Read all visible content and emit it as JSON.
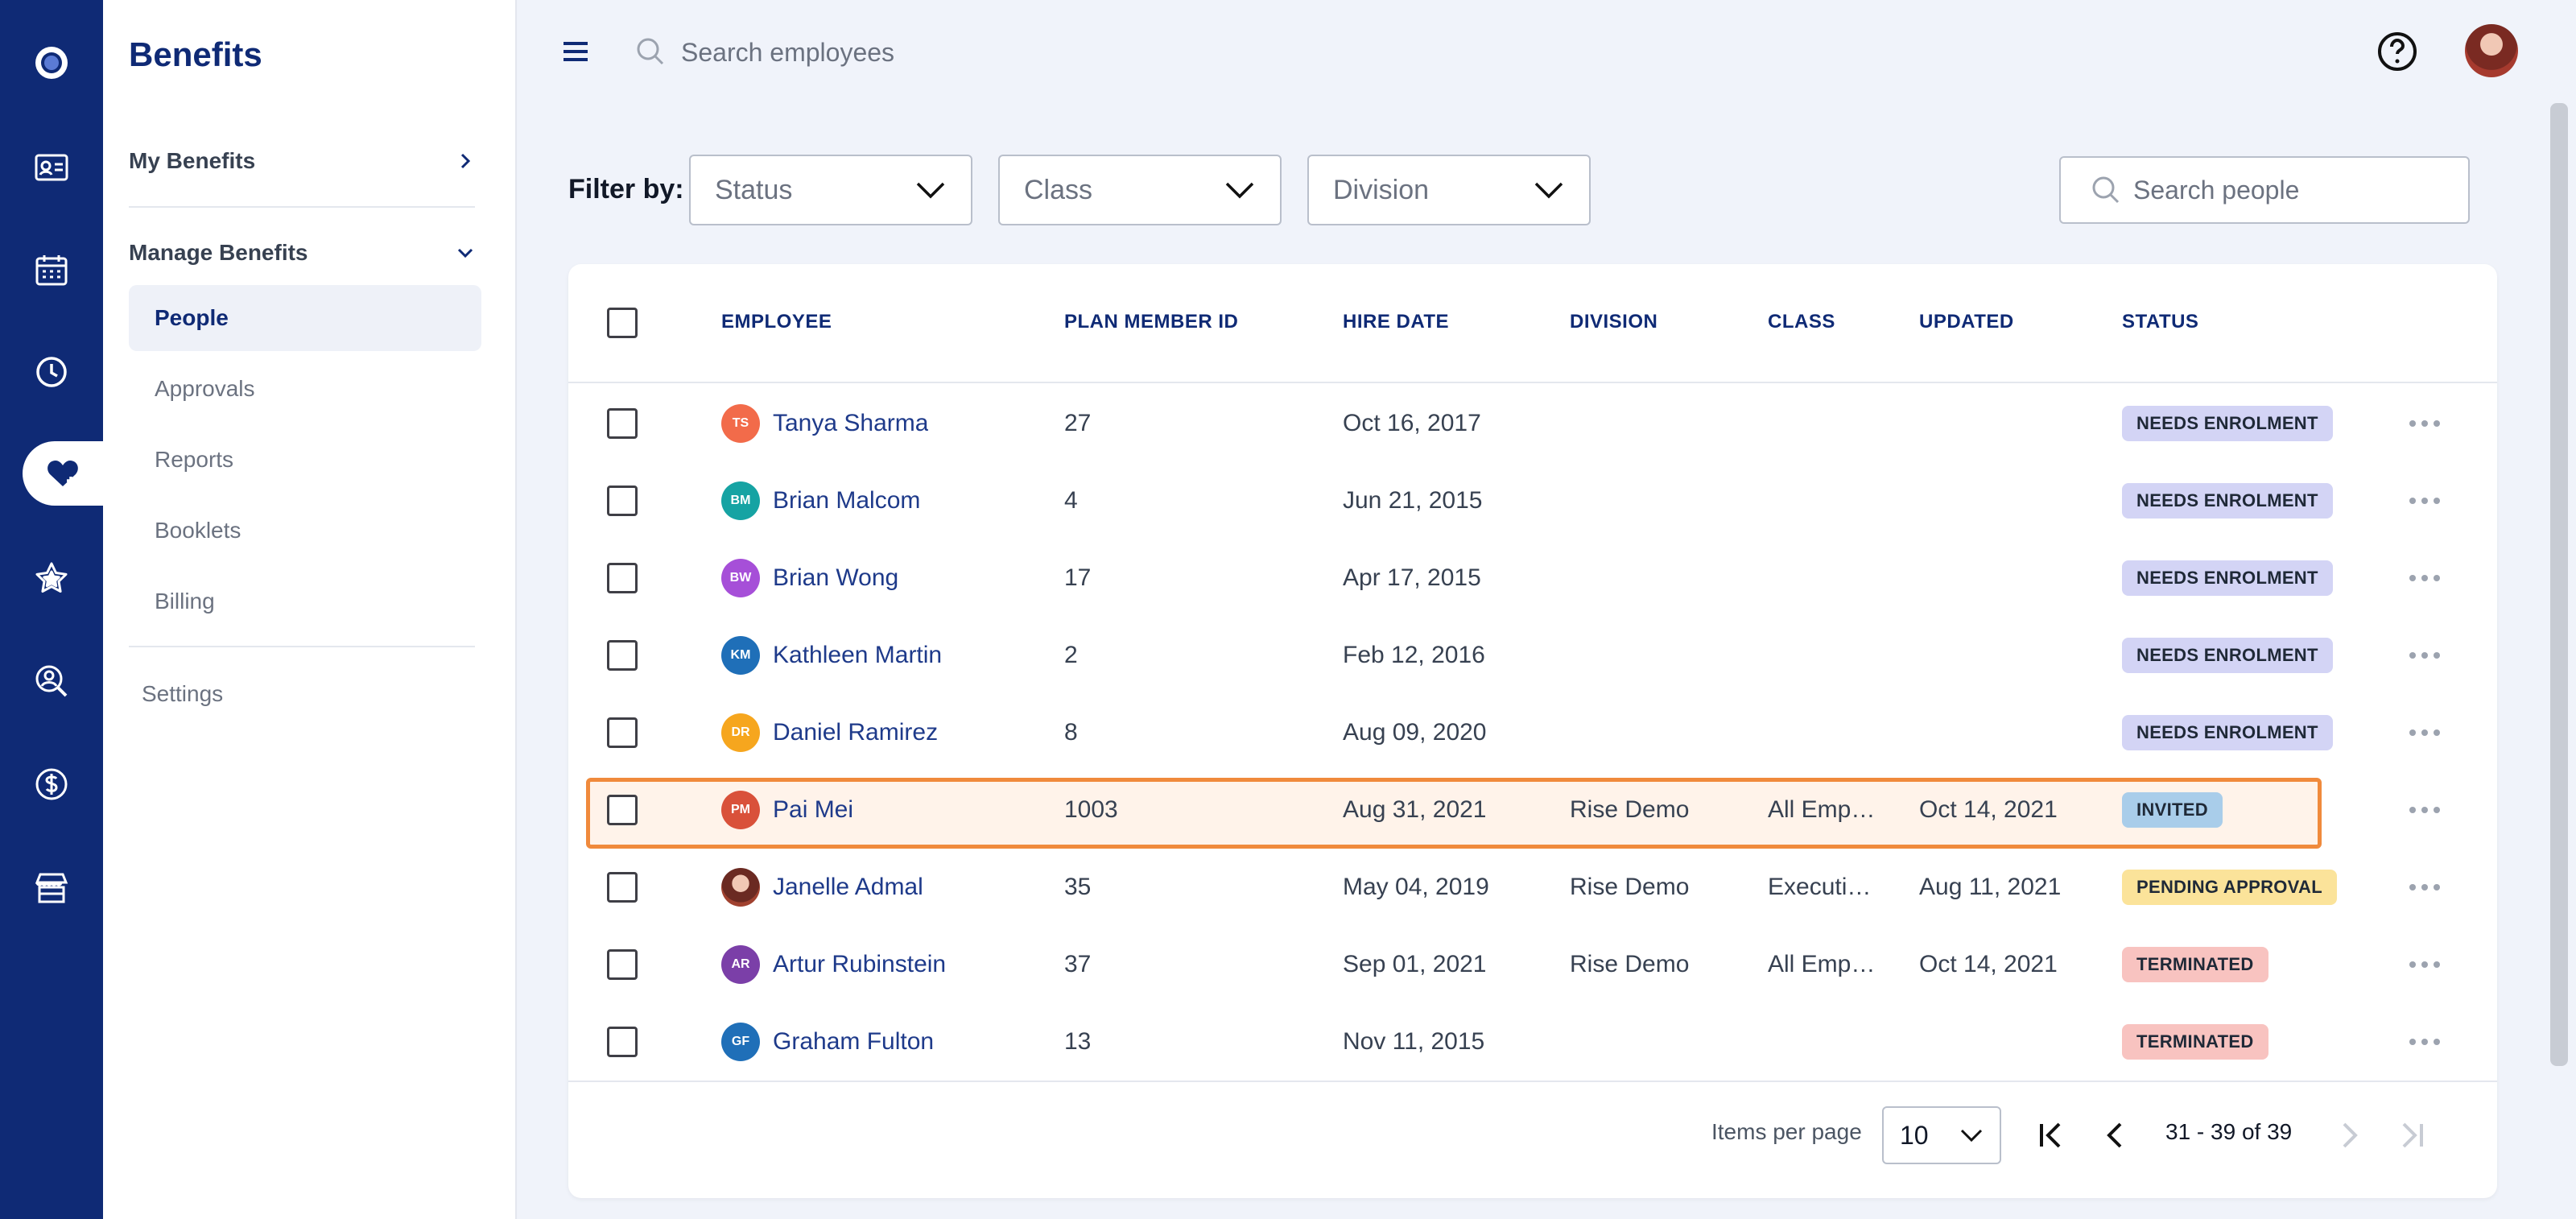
{
  "sidebar": {
    "title": "Benefits",
    "my_benefits": "My Benefits",
    "manage_benefits": "Manage Benefits",
    "items": [
      "People",
      "Approvals",
      "Reports",
      "Booklets",
      "Billing"
    ],
    "settings": "Settings"
  },
  "topbar": {
    "search_placeholder": "Search employees"
  },
  "filters": {
    "label": "Filter by:",
    "status": "Status",
    "class": "Class",
    "division": "Division",
    "search_placeholder": "Search people"
  },
  "table": {
    "headers": {
      "employee": "EMPLOYEE",
      "plan_member_id": "PLAN MEMBER ID",
      "hire_date": "HIRE DATE",
      "division": "DIVISION",
      "class": "CLASS",
      "updated": "UPDATED",
      "status": "STATUS"
    },
    "rows": [
      {
        "initials": "TS",
        "name": "Tanya Sharma",
        "id": "27",
        "hire": "Oct 16, 2017",
        "division": "",
        "class": "",
        "updated": "",
        "status": "NEEDS ENROLMENT"
      },
      {
        "initials": "BM",
        "name": "Brian Malcom",
        "id": "4",
        "hire": "Jun 21, 2015",
        "division": "",
        "class": "",
        "updated": "",
        "status": "NEEDS ENROLMENT"
      },
      {
        "initials": "BW",
        "name": "Brian Wong",
        "id": "17",
        "hire": "Apr 17, 2015",
        "division": "",
        "class": "",
        "updated": "",
        "status": "NEEDS ENROLMENT"
      },
      {
        "initials": "KM",
        "name": "Kathleen Martin",
        "id": "2",
        "hire": "Feb 12, 2016",
        "division": "",
        "class": "",
        "updated": "",
        "status": "NEEDS ENROLMENT"
      },
      {
        "initials": "DR",
        "name": "Daniel Ramirez",
        "id": "8",
        "hire": "Aug 09, 2020",
        "division": "",
        "class": "",
        "updated": "",
        "status": "NEEDS ENROLMENT"
      },
      {
        "initials": "PM",
        "name": "Pai Mei",
        "id": "1003",
        "hire": "Aug 31, 2021",
        "division": "Rise Demo",
        "class": "All Emp…",
        "updated": "Oct 14, 2021",
        "status": "INVITED"
      },
      {
        "initials": "",
        "name": "Janelle Admal",
        "id": "35",
        "hire": "May 04, 2019",
        "division": "Rise Demo",
        "class": "Executi…",
        "updated": "Aug 11, 2021",
        "status": "PENDING APPROVAL"
      },
      {
        "initials": "AR",
        "name": "Artur Rubinstein",
        "id": "37",
        "hire": "Sep 01, 2021",
        "division": "Rise Demo",
        "class": "All Emp…",
        "updated": "Oct 14, 2021",
        "status": "TERMINATED"
      },
      {
        "initials": "GF",
        "name": "Graham Fulton",
        "id": "13",
        "hire": "Nov 11, 2015",
        "division": "",
        "class": "",
        "updated": "",
        "status": "TERMINATED"
      }
    ]
  },
  "pagination": {
    "items_per_page_label": "Items per page",
    "items_per_page": "10",
    "range": "31 - 39 of 39"
  },
  "colors": {
    "brand": "#0f2a75",
    "highlight_border": "#f08a3c",
    "needs_enrolment": "#d3d4f5",
    "invited": "#a9cdea",
    "pending_approval": "#fbe39a",
    "terminated": "#f8c3c0"
  }
}
